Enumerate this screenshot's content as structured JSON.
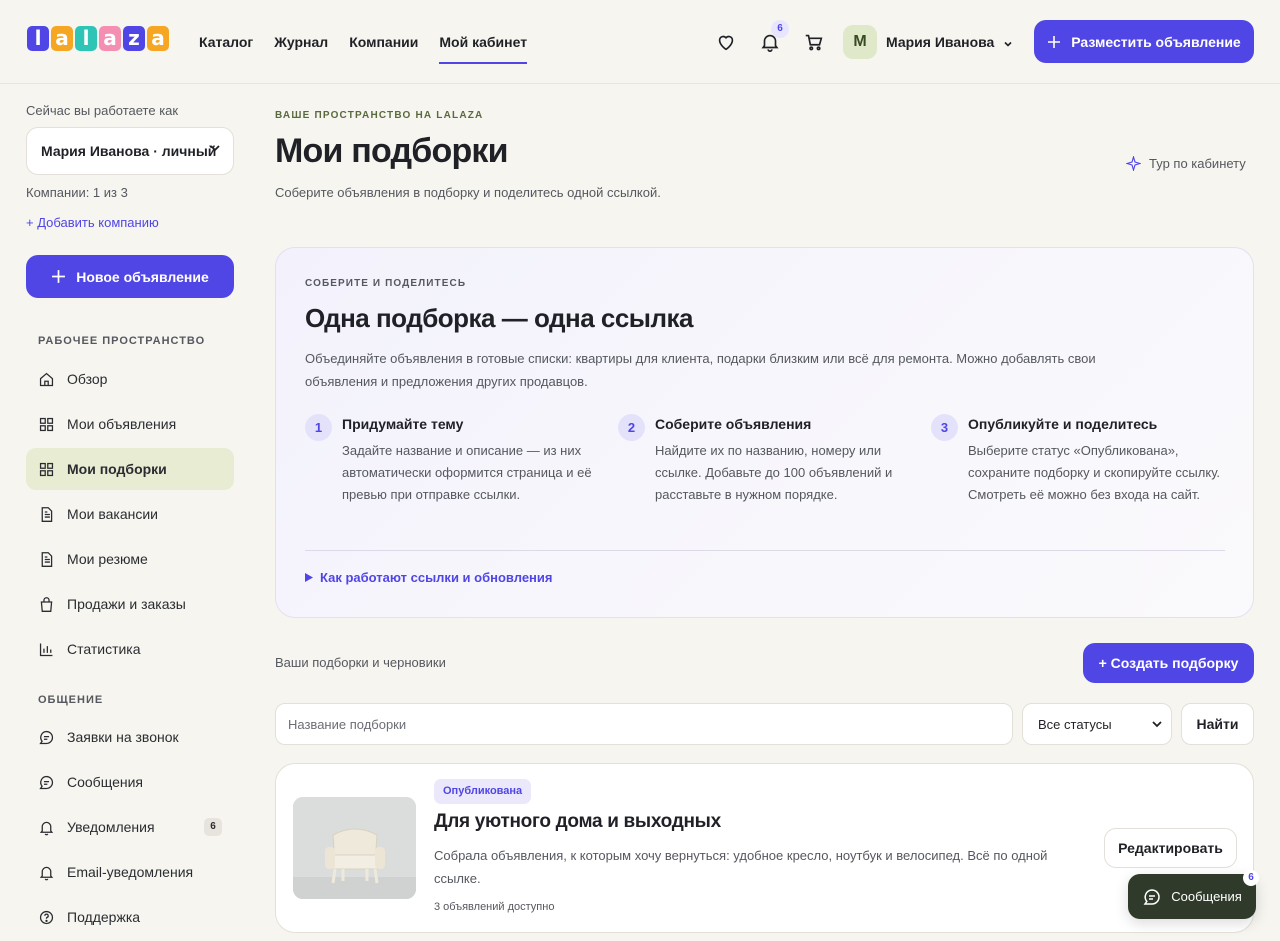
{
  "header": {
    "logo_letters": [
      "l",
      "a",
      "l",
      "a",
      "z",
      "a"
    ],
    "logo_colors": [
      "#4f46e5",
      "#f5a623",
      "#2ec4b6",
      "#f48fb1",
      "#4f46e5",
      "#f5a623"
    ],
    "nav": [
      "Каталог",
      "Журнал",
      "Компании",
      "Мой кабинет"
    ],
    "active_nav": "Мой кабинет",
    "notifications_count": "6",
    "user_initial": "М",
    "user_name": "Мария Иванова",
    "post_button": "Разместить объявление"
  },
  "sidebar": {
    "working_as_label": "Сейчас вы работаете как",
    "account_value": "Мария Иванова · личный",
    "companies_count": "Компании: 1 из 3",
    "add_company": "+ Добавить компанию",
    "new_ad_button": "Новое объявление",
    "workspace_title": "РАБОЧЕЕ ПРОСТРАНСТВО",
    "workspace_items": [
      "Обзор",
      "Мои объявления",
      "Мои подборки",
      "Мои вакансии",
      "Мои резюме",
      "Продажи и заказы",
      "Статистика"
    ],
    "active_item": "Мои подборки",
    "communication_title": "ОБЩЕНИЕ",
    "communication_items": [
      "Заявки на звонок",
      "Сообщения",
      "Уведомления",
      "Email-уведомления",
      "Поддержка"
    ],
    "notifications_badge": "6"
  },
  "main": {
    "eyebrow": "ВАШЕ ПРОСТРАНСТВО НА LALAZA",
    "title": "Мои подборки",
    "subtitle": "Соберите объявления в подборку и поделитесь одной ссылкой.",
    "tour_link": "Тур по кабинету",
    "info": {
      "eyebrow": "СОБЕРИТЕ И ПОДЕЛИТЕСЬ",
      "title": "Одна подборка — одна ссылка",
      "description": "Объединяйте объявления в готовые списки: квартиры для клиента, подарки близким или всё для ремонта. Можно добавлять свои объявления и предложения других продавцов.",
      "steps": [
        {
          "num": "1",
          "title": "Придумайте тему",
          "text": "Задайте название и описание — из них автоматически оформится страница и её превью при отправке ссылки."
        },
        {
          "num": "2",
          "title": "Соберите объявления",
          "text": "Найдите их по названию, номеру или ссылке. Добавьте до 100 объявлений и расставьте в нужном порядке."
        },
        {
          "num": "3",
          "title": "Опубликуйте и поделитесь",
          "text": "Выберите статус «Опубликована», сохраните подборку и скопируйте ссылку. Смотреть её можно без входа на сайт."
        }
      ],
      "details_link": "Как работают ссылки и обновления"
    },
    "list_label": "Ваши подборки и черновики",
    "create_button": "+ Создать подборку",
    "search_placeholder": "Название подборки",
    "status_filter": "Все статусы",
    "find_button": "Найти",
    "collection": {
      "status": "Опубликована",
      "title": "Для уютного дома и выходных",
      "description": "Собрала объявления, к которым хочу вернуться: удобное кресло, ноутбук и велосипед. Всё по одной ссылке.",
      "meta": "3 объявлений доступно",
      "edit_button": "Редактировать"
    }
  },
  "messages_fab": {
    "label": "Сообщения",
    "badge": "6"
  }
}
